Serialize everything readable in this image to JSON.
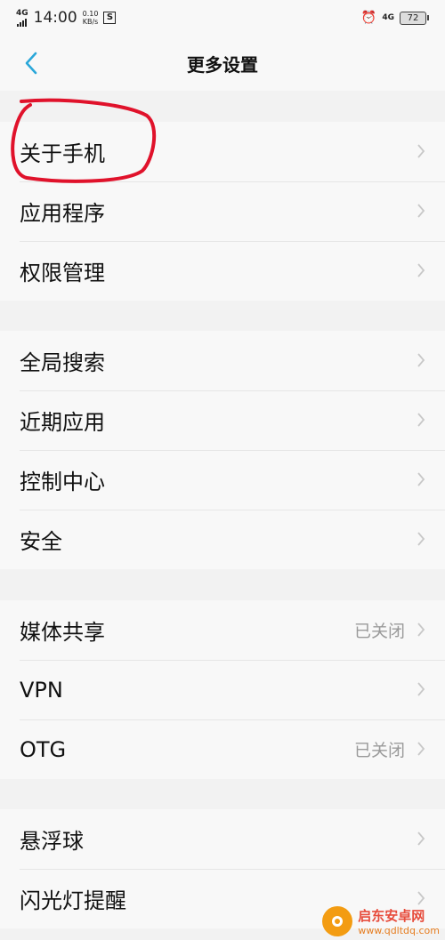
{
  "status_bar": {
    "signal": "4G",
    "time": "14:00",
    "net_speed_value": "0.10",
    "net_speed_unit": "KB/s",
    "s_icon": "S",
    "lte": "4G",
    "battery": "72"
  },
  "header": {
    "title": "更多设置"
  },
  "groups": [
    {
      "items": [
        {
          "label": "关于手机"
        },
        {
          "label": "应用程序"
        },
        {
          "label": "权限管理"
        }
      ]
    },
    {
      "items": [
        {
          "label": "全局搜索"
        },
        {
          "label": "近期应用"
        },
        {
          "label": "控制中心"
        },
        {
          "label": "安全"
        }
      ]
    },
    {
      "items": [
        {
          "label": "媒体共享",
          "value": "已关闭"
        },
        {
          "label": "VPN"
        },
        {
          "label": "OTG",
          "value": "已关闭"
        }
      ]
    },
    {
      "items": [
        {
          "label": "悬浮球"
        },
        {
          "label": "闪光灯提醒"
        }
      ]
    }
  ],
  "watermark": {
    "title": "启东安卓网",
    "url": "www.qdltdq.com"
  },
  "colors": {
    "accent": "#2aa7d9",
    "annotation": "#e0122b",
    "chevron": "#c8c8c8",
    "value_text": "#9a9a9a"
  }
}
